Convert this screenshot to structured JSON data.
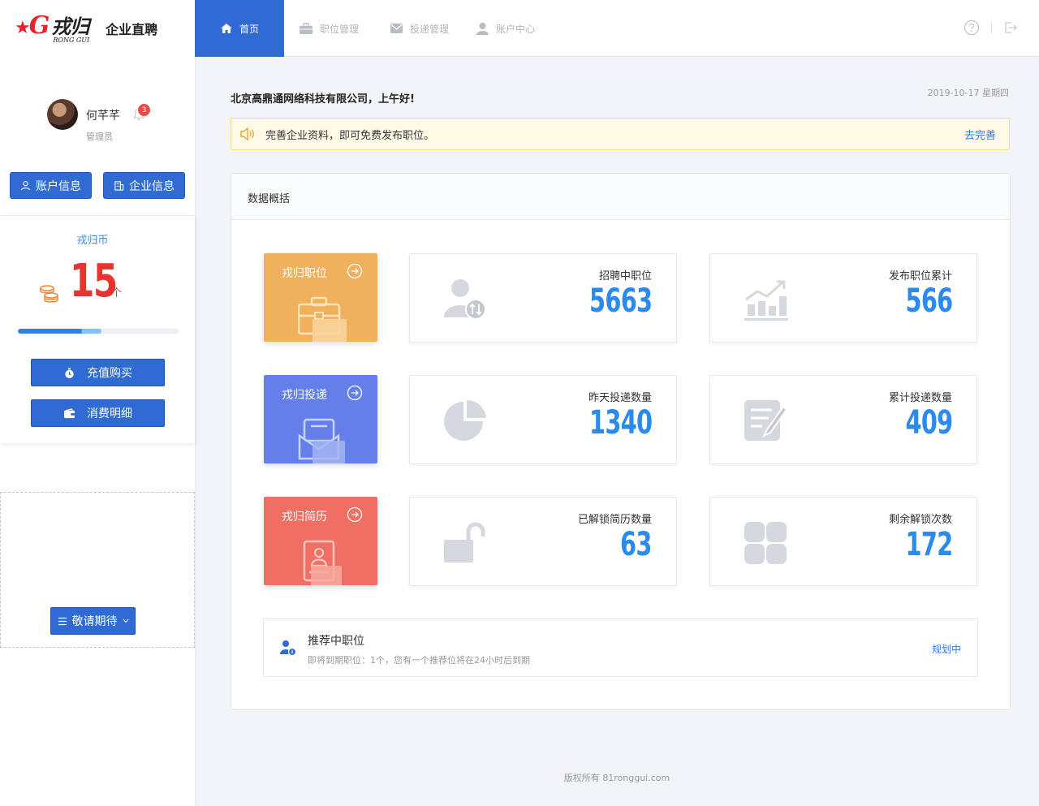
{
  "brand": {
    "logo_cn": "戎归",
    "logo_en": "RONG GUI",
    "subtitle": "企业直聘"
  },
  "user": {
    "name": "何芊芊",
    "role": "管理员",
    "notifications": "3"
  },
  "sidebar": {
    "account_button": "账户信息",
    "company_button": "企业信息",
    "coin": {
      "title": "戎归币",
      "amount": "15",
      "unit": "个",
      "progress": 0.52
    },
    "recharge_button": "充值购买",
    "detail_button": "消费明细",
    "coming_button": "敬请期待"
  },
  "nav": {
    "items": [
      {
        "label": "首页",
        "icon": "home-icon",
        "active": true
      },
      {
        "label": "职位管理",
        "icon": "briefcase-icon",
        "active": false
      },
      {
        "label": "投递管理",
        "icon": "mail-icon",
        "active": false
      },
      {
        "label": "账户中心",
        "icon": "user-icon",
        "active": false
      }
    ],
    "help_icon": "help-icon",
    "logout_icon": "logout-icon"
  },
  "main": {
    "greeting": "北京高鼎通网络科技有限公司，上午好!",
    "date": "2019-10-17 星期四",
    "notice": {
      "text": "完善企业资料，即可免费发布职位。",
      "link": "去完善"
    },
    "panel_title": "数据概括",
    "features": [
      {
        "title": "戎归职位",
        "color": "#f0b15d"
      },
      {
        "title": "戎归投递",
        "color": "#6480e8"
      },
      {
        "title": "戎归简历",
        "color": "#f06f62"
      }
    ],
    "stats": [
      {
        "label": "招聘中职位",
        "value": "5663",
        "icon": "user-transfer-icon"
      },
      {
        "label": "发布职位累计",
        "value": "566",
        "icon": "chart-trend-icon"
      },
      {
        "label": "昨天投递数量",
        "value": "1340",
        "icon": "pie-chart-icon"
      },
      {
        "label": "累计投递数量",
        "value": "409",
        "icon": "edit-document-icon"
      },
      {
        "label": "已解锁简历数量",
        "value": "63",
        "icon": "unlock-icon"
      },
      {
        "label": "剩余解锁次数",
        "value": "172",
        "icon": "grid-icon"
      }
    ],
    "recommend": {
      "title": "推荐中职位",
      "desc": "即将到期职位：1个，您有一个推荐位将在24小时后到期",
      "link": "规划中"
    }
  },
  "footer": "版权所有 81ronggui.com"
}
